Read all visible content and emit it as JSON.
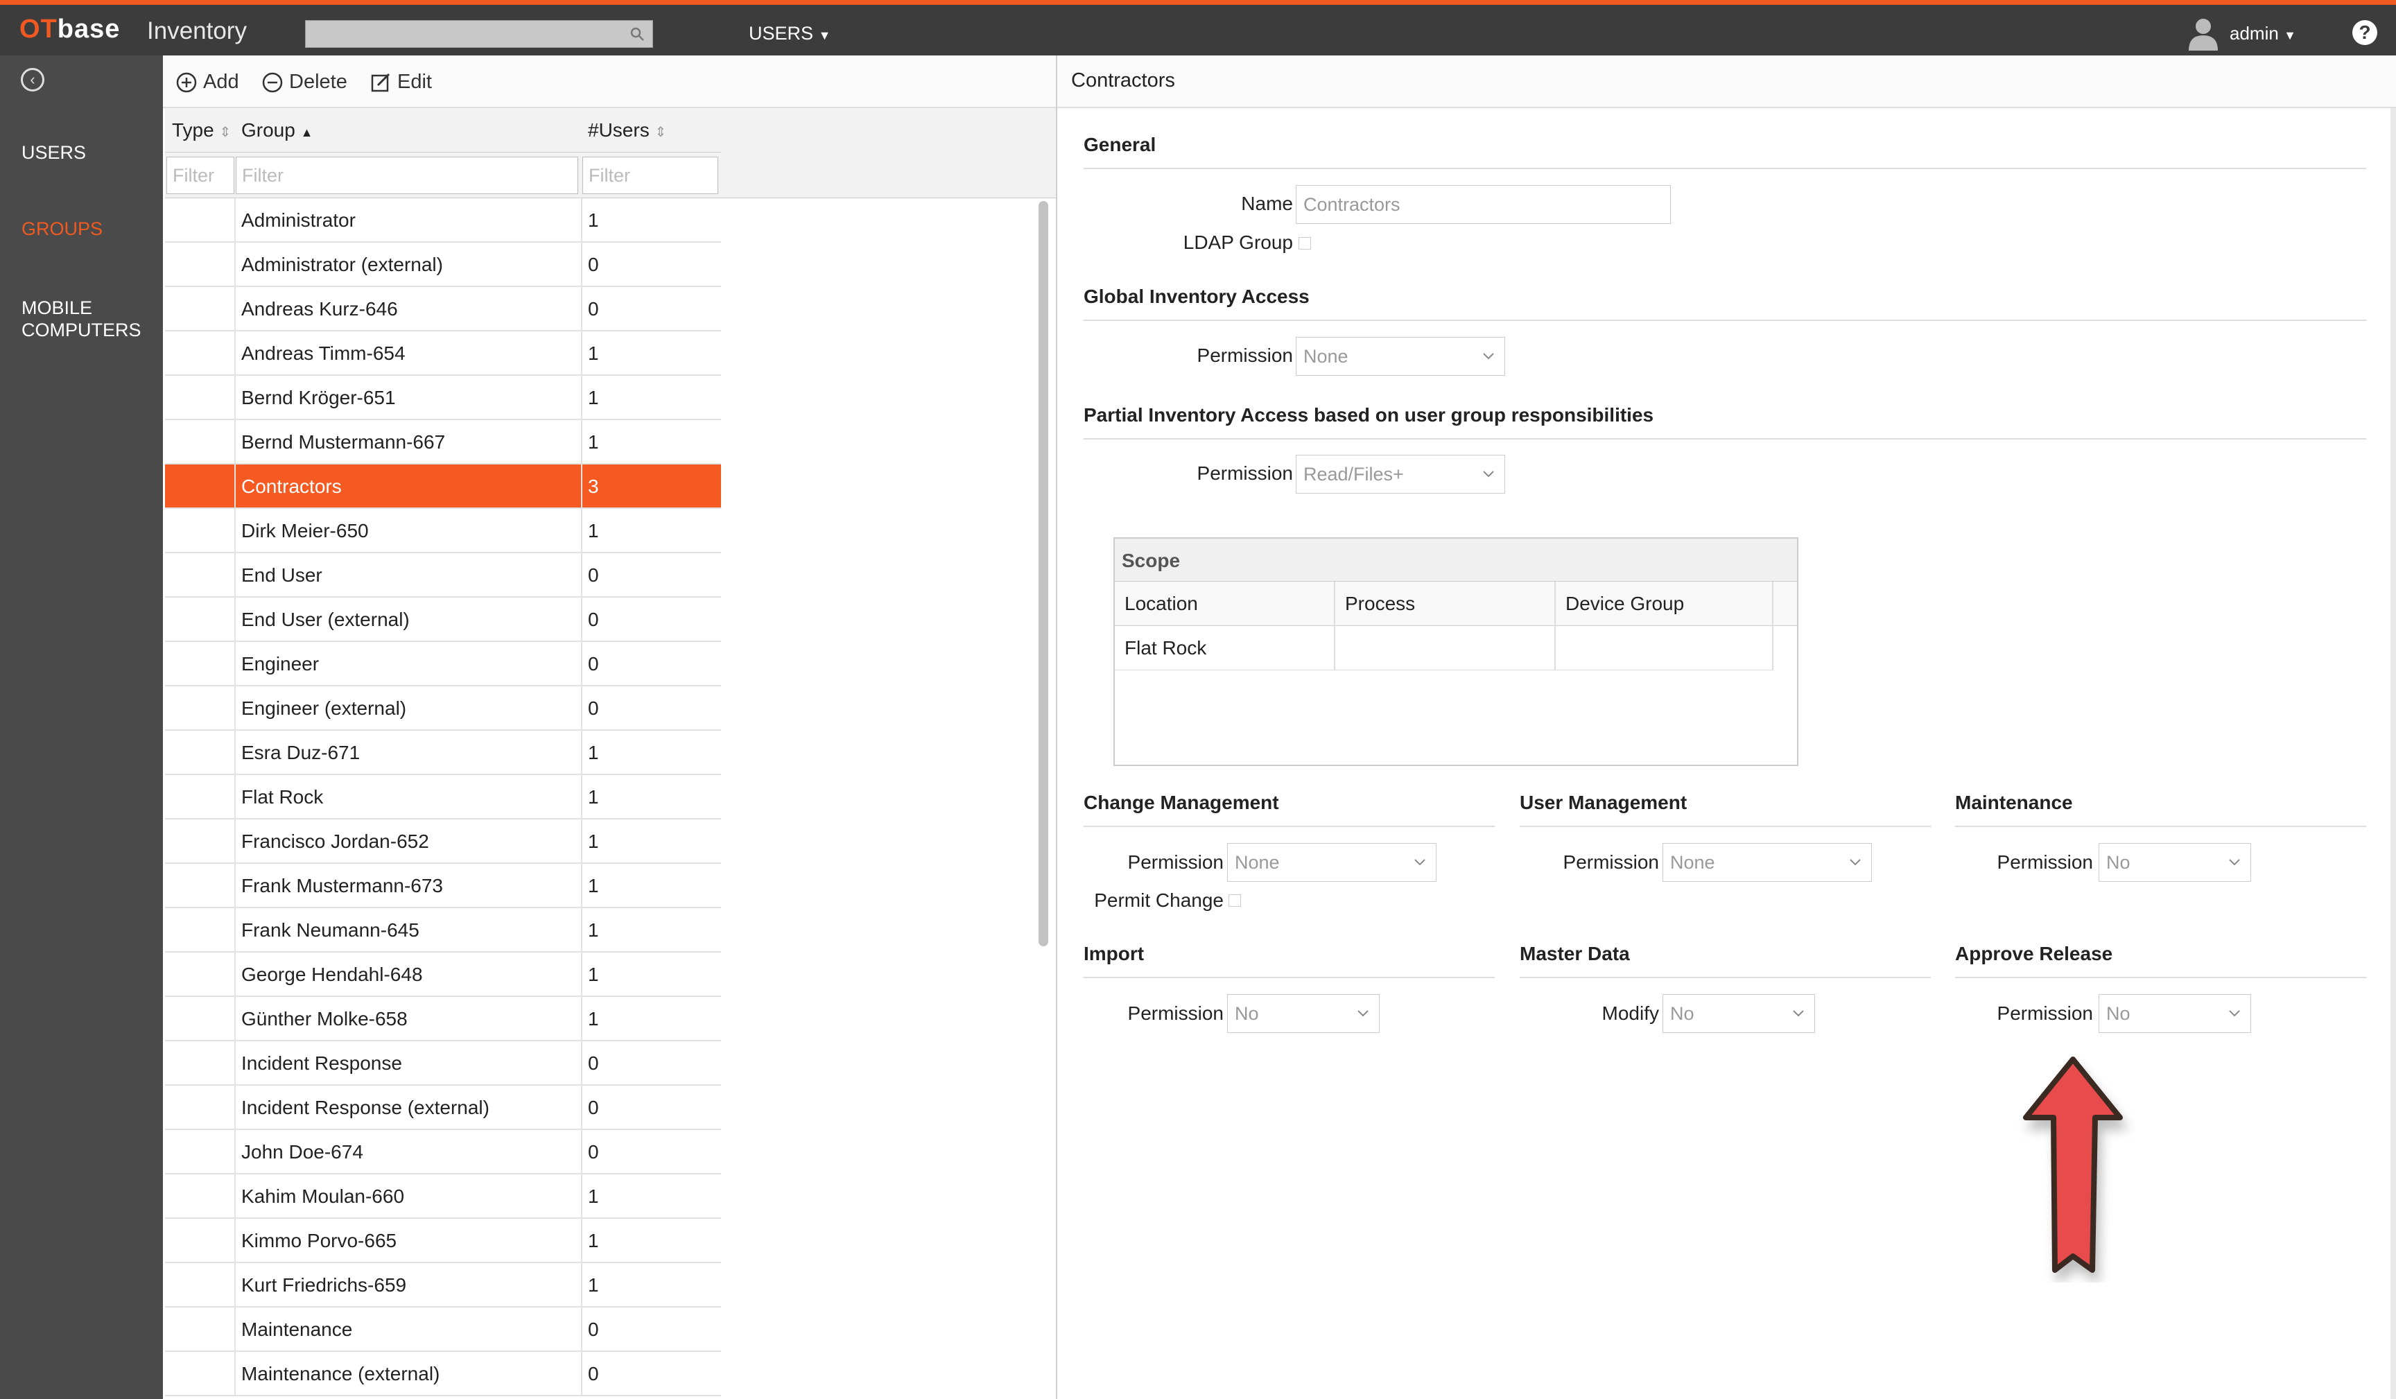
{
  "app": {
    "logo_prefix": "OT",
    "logo_suffix": "base",
    "product": "Inventory",
    "nav_menu": "USERS",
    "user": "admin"
  },
  "sidebar": {
    "items": [
      {
        "label": "USERS"
      },
      {
        "label": "GROUPS"
      },
      {
        "label": "MOBILE COMPUTERS"
      }
    ]
  },
  "toolbar": {
    "add_label": "Add",
    "delete_label": "Delete",
    "edit_label": "Edit"
  },
  "table": {
    "columns": {
      "type": "Type",
      "group": "Group",
      "users": "#Users"
    },
    "filter_placeholder": "Filter",
    "rows": [
      {
        "group": "Administrator",
        "users": "1"
      },
      {
        "group": "Administrator (external)",
        "users": "0"
      },
      {
        "group": "Andreas Kurz-646",
        "users": "0"
      },
      {
        "group": "Andreas Timm-654",
        "users": "1"
      },
      {
        "group": "Bernd Kröger-651",
        "users": "1"
      },
      {
        "group": "Bernd Mustermann-667",
        "users": "1"
      },
      {
        "group": "Contractors",
        "users": "3"
      },
      {
        "group": "Dirk Meier-650",
        "users": "1"
      },
      {
        "group": "End User",
        "users": "0"
      },
      {
        "group": "End User (external)",
        "users": "0"
      },
      {
        "group": "Engineer",
        "users": "0"
      },
      {
        "group": "Engineer (external)",
        "users": "0"
      },
      {
        "group": "Esra Duz-671",
        "users": "1"
      },
      {
        "group": "Flat Rock",
        "users": "1"
      },
      {
        "group": "Francisco Jordan-652",
        "users": "1"
      },
      {
        "group": "Frank Mustermann-673",
        "users": "1"
      },
      {
        "group": "Frank Neumann-645",
        "users": "1"
      },
      {
        "group": "George Hendahl-648",
        "users": "1"
      },
      {
        "group": "Günther Molke-658",
        "users": "1"
      },
      {
        "group": "Incident Response",
        "users": "0"
      },
      {
        "group": "Incident Response (external)",
        "users": "0"
      },
      {
        "group": "John Doe-674",
        "users": "0"
      },
      {
        "group": "Kahim Moulan-660",
        "users": "1"
      },
      {
        "group": "Kimmo Porvo-665",
        "users": "1"
      },
      {
        "group": "Kurt Friedrichs-659",
        "users": "1"
      },
      {
        "group": "Maintenance",
        "users": "0"
      },
      {
        "group": "Maintenance (external)",
        "users": "0"
      }
    ]
  },
  "detail": {
    "title": "Contractors",
    "general": {
      "title": "General",
      "name_label": "Name",
      "name_value": "Contractors",
      "ldap_label": "LDAP Group"
    },
    "global_access": {
      "title": "Global Inventory Access",
      "permission_label": "Permission",
      "permission_value": "None"
    },
    "partial_access": {
      "title": "Partial Inventory Access based on user group responsibilities",
      "permission_label": "Permission",
      "permission_value": "Read/Files+"
    },
    "scope": {
      "title": "Scope",
      "columns": [
        "Location",
        "Process",
        "Device Group"
      ],
      "rows": [
        {
          "location": "Flat Rock",
          "process": "",
          "device_group": ""
        }
      ]
    },
    "change_management": {
      "title": "Change Management",
      "permission_label": "Permission",
      "permission_value": "None",
      "permit_change_label": "Permit Change"
    },
    "user_management": {
      "title": "User Management",
      "permission_label": "Permission",
      "permission_value": "None"
    },
    "maintenance": {
      "title": "Maintenance",
      "permission_label": "Permission",
      "permission_value": "No"
    },
    "import": {
      "title": "Import",
      "permission_label": "Permission",
      "permission_value": "No"
    },
    "master_data": {
      "title": "Master Data",
      "modify_label": "Modify",
      "modify_value": "No"
    },
    "approve_release": {
      "title": "Approve Release",
      "permission_label": "Permission",
      "permission_value": "No"
    }
  },
  "colors": {
    "brand": "#f05a22",
    "selected_row": "#f55a22",
    "topbar": "#3c3c3c",
    "sidebar": "#4a4a4a",
    "arrow": "#e84b4b"
  }
}
